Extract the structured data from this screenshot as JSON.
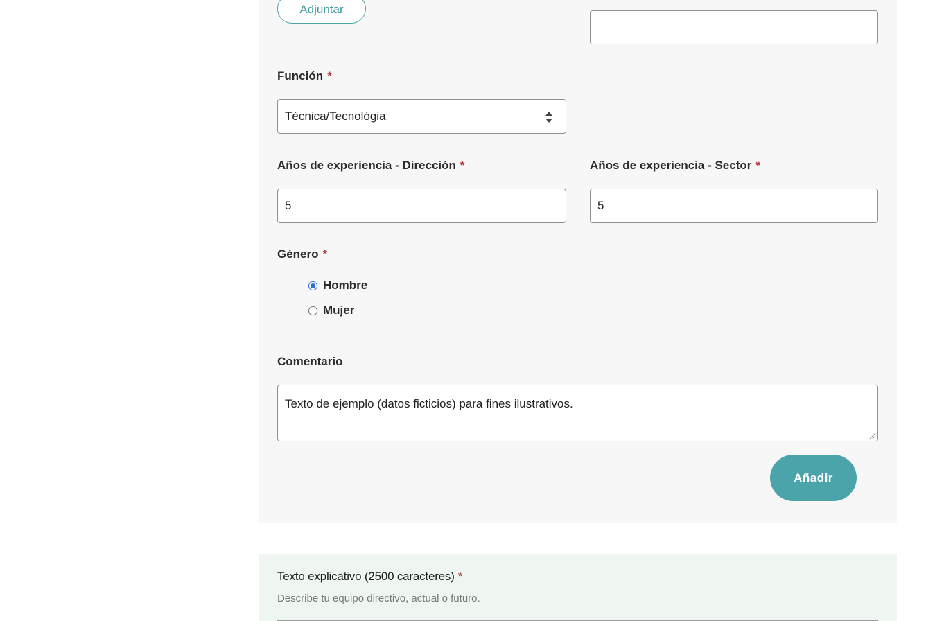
{
  "attach_button": {
    "label": "Adjuntar"
  },
  "top_right_input": {
    "value": ""
  },
  "funcion": {
    "label": "Función",
    "required_mark": "*",
    "selected": "Técnica/Tecnológia"
  },
  "exp_direccion": {
    "label": "Años de experiencia - Dirección",
    "required_mark": "*",
    "value": "5"
  },
  "exp_sector": {
    "label": "Años de experiencia - Sector",
    "required_mark": "*",
    "value": "5"
  },
  "genero": {
    "label": "Género",
    "required_mark": "*",
    "options": [
      {
        "label": "Hombre",
        "checked": true
      },
      {
        "label": "Mujer",
        "checked": false
      }
    ]
  },
  "comentario": {
    "label": "Comentario",
    "value": "Texto de ejemplo (datos ficticios) para fines ilustrativos."
  },
  "add_button": {
    "label": "Añadir"
  },
  "texto_explicativo": {
    "label": "Texto explicativo (2500 caracteres)",
    "required_mark": "*",
    "help": "Describe tu equipo directivo, actual o futuro."
  },
  "colors": {
    "accent": "#4aa4aa",
    "required": "#b5373b",
    "radio_checked": "#2a6fdb",
    "panel_bg": "#f7f7f7",
    "explain_bg": "#eff6f2"
  }
}
